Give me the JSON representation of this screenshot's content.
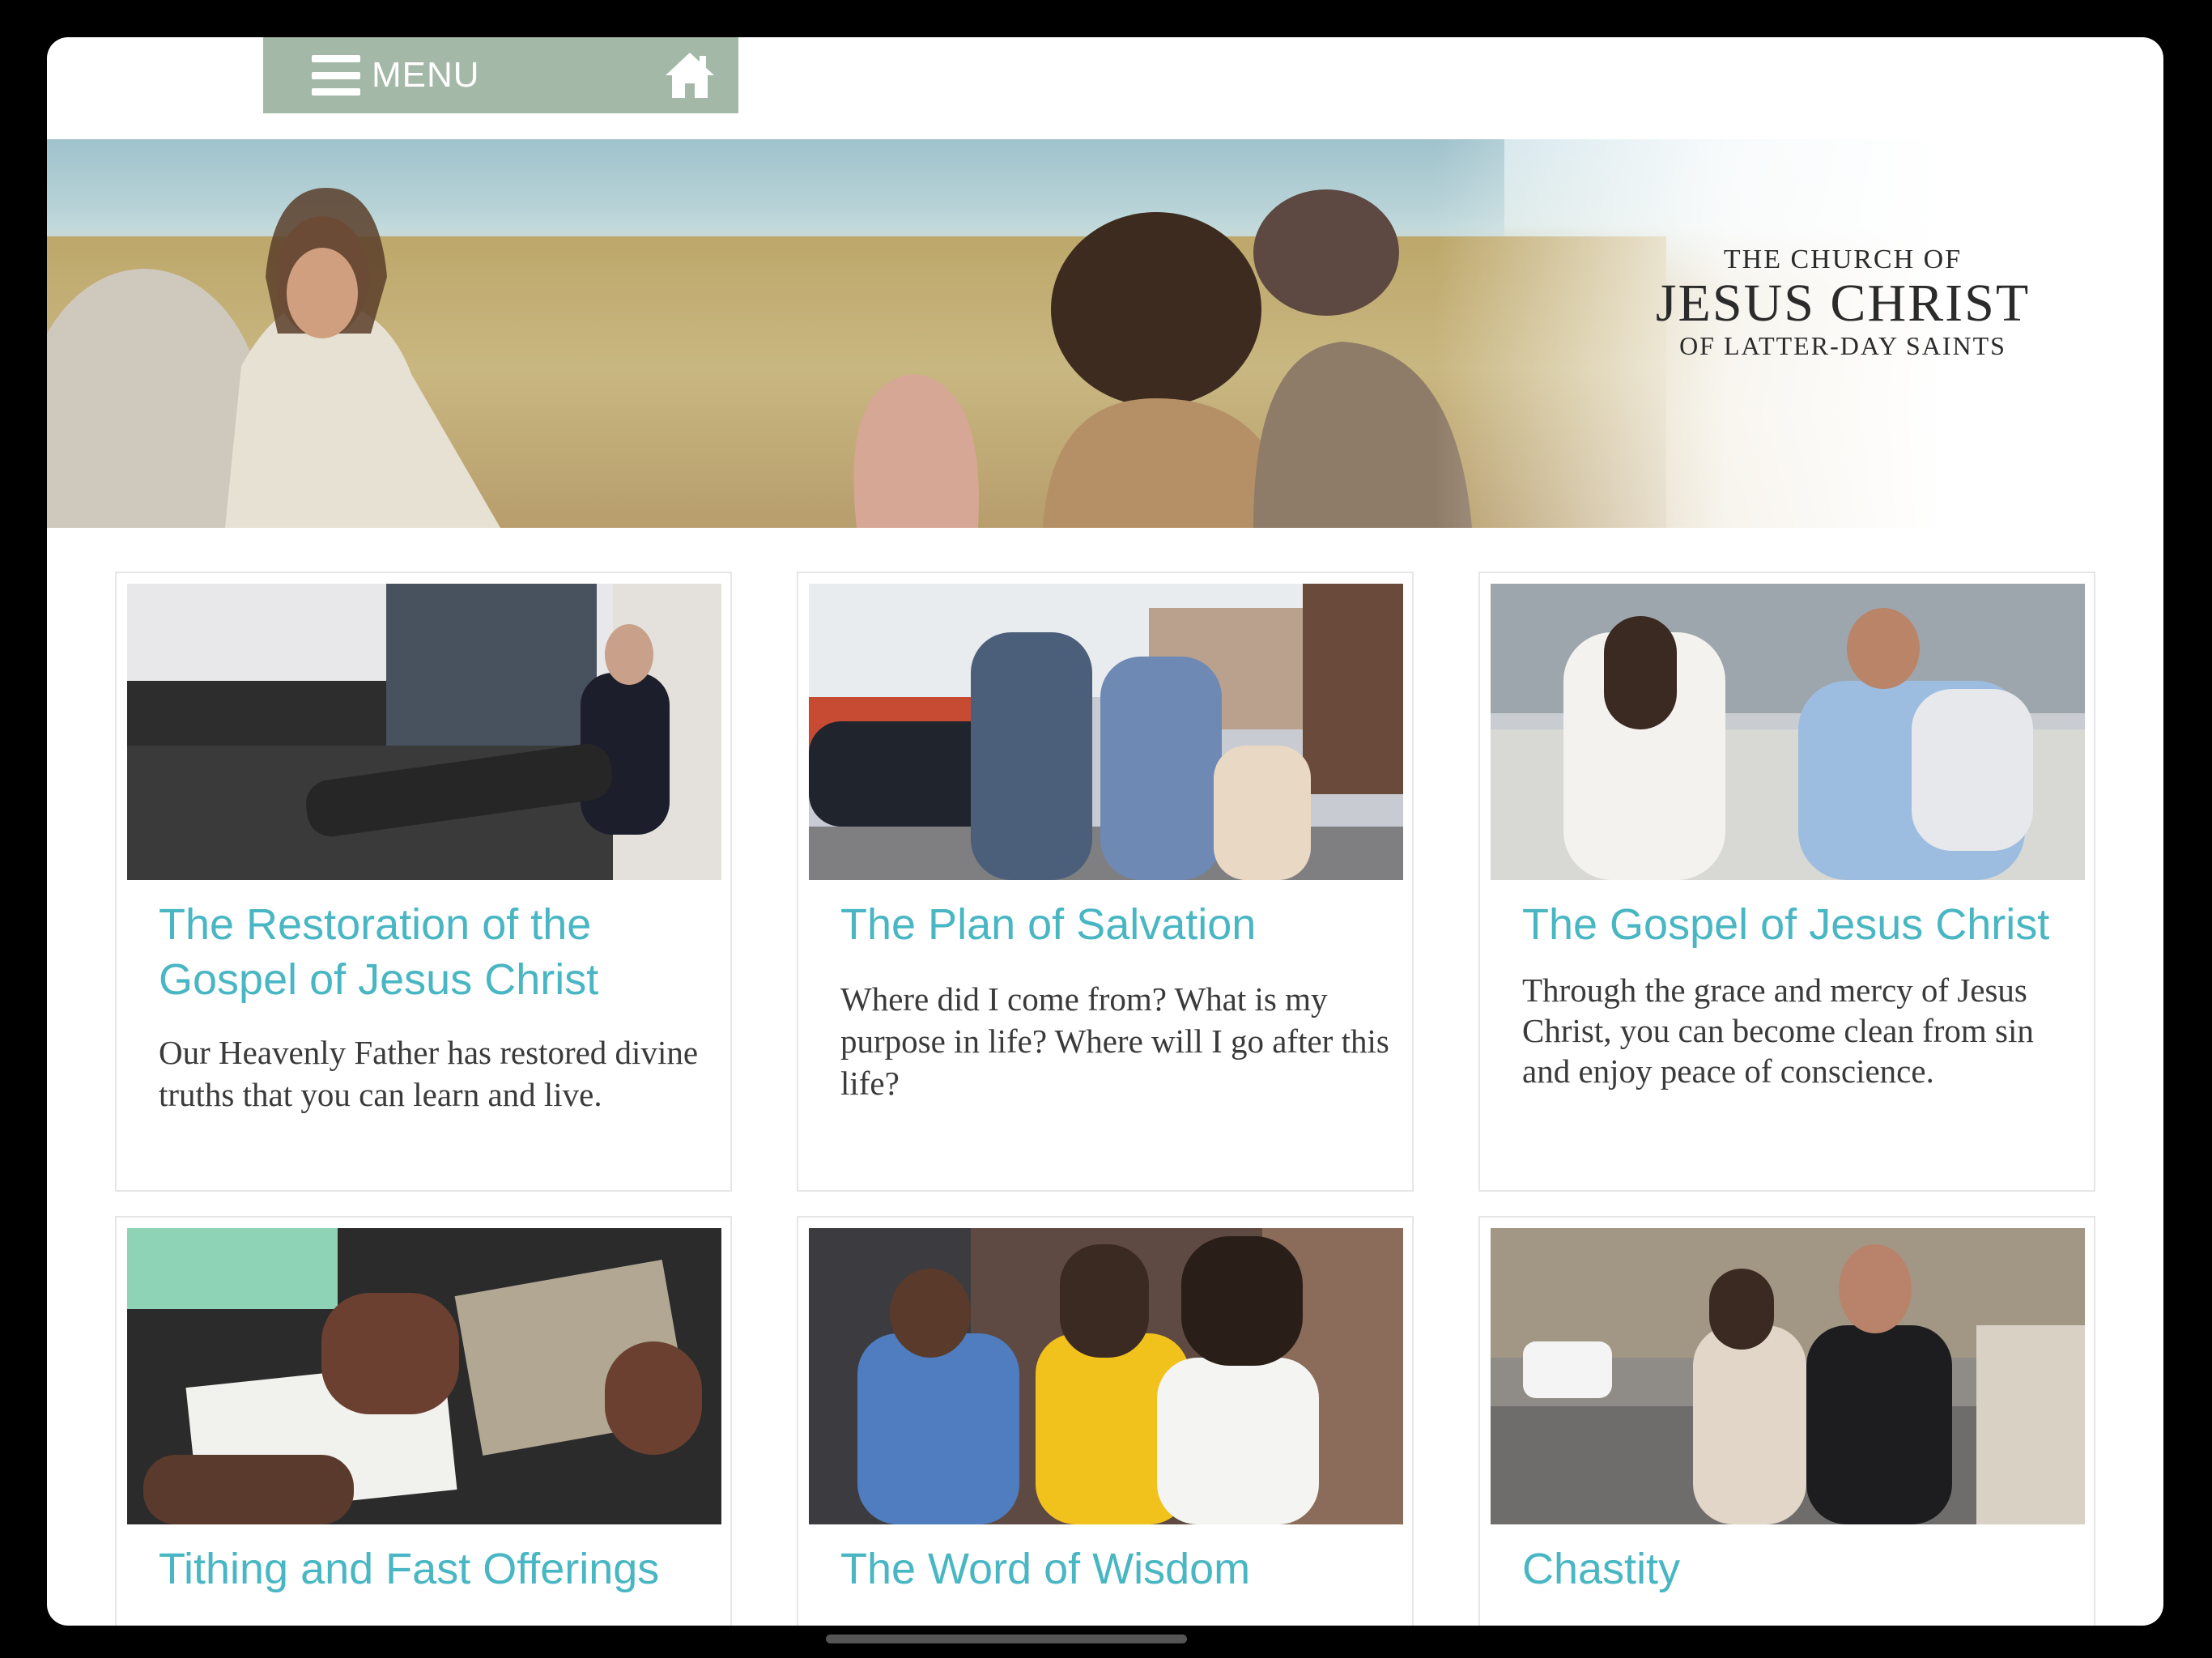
{
  "header": {
    "menu_label": "MENU",
    "home_icon": "home-icon",
    "menu_icon": "hamburger-icon",
    "accent_color": "#a3b8a6"
  },
  "hero": {
    "logo_line1": "THE CHURCH OF",
    "logo_line2": "JESUS CHRIST",
    "logo_line3": "OF LATTER-DAY SAINTS"
  },
  "cards": [
    {
      "title": "The Restoration of the Gospel of Jesus Christ",
      "description": "Our Heavenly Father has restored divine truths that you can learn and live."
    },
    {
      "title": "The Plan of Salvation",
      "description": "Where did I come from? What is my purpose in life? Where will I go after this life?"
    },
    {
      "title": "The Gospel of Jesus Christ",
      "description": "Through the grace and mercy of Jesus Christ, you can become clean from sin and enjoy peace of conscience."
    },
    {
      "title": "Tithing and Fast Offerings",
      "description": ""
    },
    {
      "title": "The Word of Wisdom",
      "description": ""
    },
    {
      "title": "Chastity",
      "description": ""
    }
  ],
  "colors": {
    "title_color": "#49b6c3",
    "body_text": "#3a3a3a"
  }
}
